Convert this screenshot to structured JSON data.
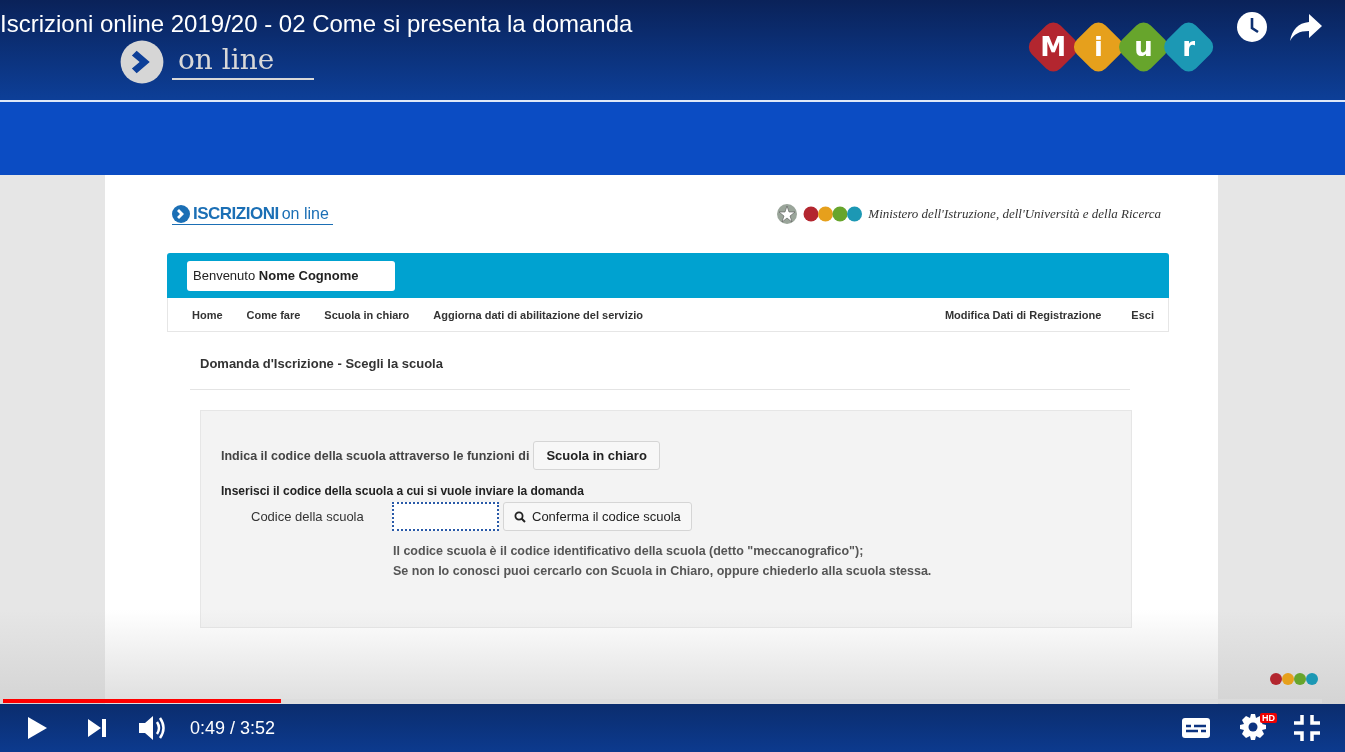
{
  "video": {
    "title": "Iscrizioni online 2019/20 - 02 Come si presenta la domanda",
    "overlay_logo_text": "on line",
    "channel_logo_letters": [
      "M",
      "i",
      "u",
      "r"
    ]
  },
  "page": {
    "logo": {
      "strong": "ISCRIZIONI",
      "light": "on line"
    },
    "ministry": "Ministero dell'Istruzione, dell'Università e della Ricerca",
    "welcome": {
      "label": "Benvenuto",
      "name": "Nome Cognome"
    },
    "nav_left": [
      "Home",
      "Come fare",
      "Scuola in chiaro",
      "Aggiorna dati di abilitazione del servizio"
    ],
    "nav_right": [
      "Modifica Dati di Registrazione",
      "Esci"
    ],
    "heading": "Domanda d'Iscrizione - Scegli la scuola",
    "intro": "Indica il codice della scuola attraverso le funzioni di",
    "intro_button": "Scuola in chiaro",
    "section_label": "Inserisci il codice della scuola a cui si vuole inviare la domanda",
    "field": {
      "label": "Codice della scuola",
      "focused": true
    },
    "confirm_button": "Conferma il codice scuola",
    "help": [
      "Il codice scuola è il codice identificativo della scuola (detto \"meccanografico\");",
      "Se non lo conosci puoi cercarlo con Scuola in Chiaro, oppure chiederlo alla scuola stessa."
    ]
  },
  "player": {
    "progress": {
      "level": 0.211
    },
    "time": "0:49 / 3:52",
    "quality_badge": "HD"
  }
}
